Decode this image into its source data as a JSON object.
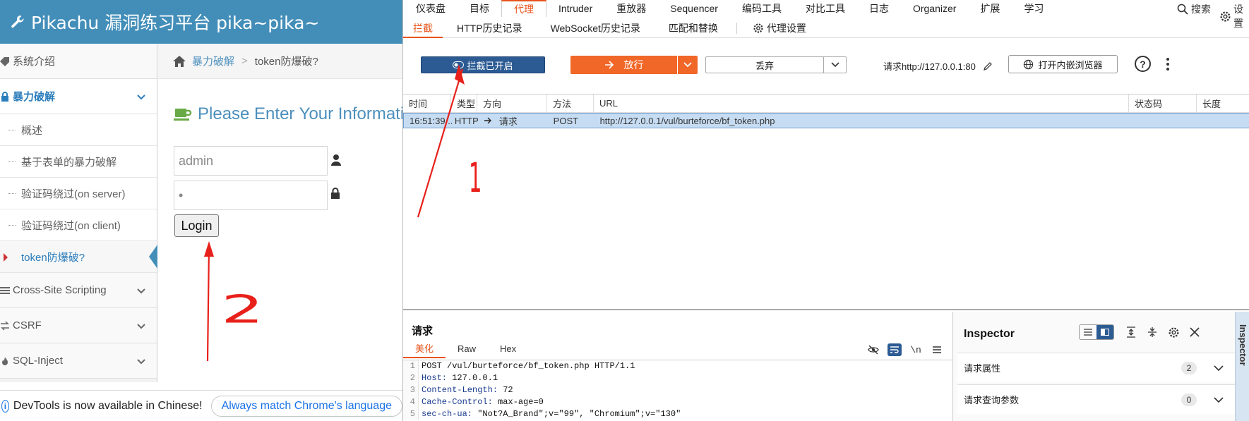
{
  "pikachu": {
    "header_title": "Pikachu 漏洞练习平台 pika~pika~",
    "sidebar": {
      "items": [
        {
          "label": "系统介绍"
        },
        {
          "label": "暴力破解"
        },
        {
          "label": "Cross-Site Scripting"
        },
        {
          "label": "CSRF"
        },
        {
          "label": "SQL-Inject"
        }
      ],
      "sub_items": [
        {
          "label": "概述"
        },
        {
          "label": "基于表单的暴力破解"
        },
        {
          "label": "验证码绕过(on server)"
        },
        {
          "label": "验证码绕过(on client)"
        },
        {
          "label": "token防爆破?"
        }
      ]
    },
    "breadcrumb": {
      "link": "暴力破解",
      "sep": ">",
      "current": "token防爆破?"
    },
    "form": {
      "title": "Please Enter Your Information",
      "username_value": "admin",
      "password_value": "•",
      "login_label": "Login"
    },
    "devtools": {
      "message": "DevTools is now available in Chinese!",
      "button": "Always match Chrome's language"
    }
  },
  "burp": {
    "tabs": [
      "仪表盘",
      "目标",
      "代理",
      "Intruder",
      "重放器",
      "Sequencer",
      "编码工具",
      "对比工具",
      "日志",
      "Organizer",
      "扩展",
      "学习"
    ],
    "active_tab": "代理",
    "search_label": "搜索",
    "settings_label": "设置",
    "sub_tabs": [
      "拦截",
      "HTTP历史记录",
      "WebSocket历史记录",
      "匹配和替换"
    ],
    "proxy_settings_label": "代理设置",
    "intercept_label": "拦截已开启",
    "forward_label": "放行",
    "drop_label": "丢弃",
    "request_target": "请求http://127.0.0.1:80",
    "open_browser_label": "打开内嵌浏览器",
    "history": {
      "columns": [
        "时间",
        "类型",
        "方向",
        "方法",
        "URL",
        "状态码",
        "长度"
      ],
      "rows": [
        {
          "time": "16:51:39 ...",
          "type": "HTTP",
          "direction": "请求",
          "method": "POST",
          "url": "http://127.0.0.1/vul/burteforce/bf_token.php",
          "status": "",
          "length": ""
        }
      ]
    },
    "request": {
      "title": "请求",
      "tabs": [
        "美化",
        "Raw",
        "Hex"
      ],
      "lines": [
        {
          "n": "1",
          "key": "",
          "text": "POST /vul/burteforce/bf_token.php HTTP/1.1"
        },
        {
          "n": "2",
          "key": "Host:",
          "text": " 127.0.0.1"
        },
        {
          "n": "3",
          "key": "Content-Length:",
          "text": " 72"
        },
        {
          "n": "4",
          "key": "Cache-Control:",
          "text": " max-age=0"
        },
        {
          "n": "5",
          "key": "sec-ch-ua:",
          "text": " \"Not?A_Brand\";v=\"99\", \"Chromium\";v=\"130\""
        }
      ]
    },
    "inspector": {
      "title": "Inspector",
      "strip_label": "Inspector",
      "rows": [
        {
          "label": "请求属性",
          "count": "2"
        },
        {
          "label": "请求查询参数",
          "count": "0"
        }
      ]
    },
    "annotations": {
      "num1": "1",
      "num2": "2"
    }
  },
  "colors": {
    "pika_header": "#438eb9",
    "burp_accent": "#e8531a",
    "forward_button": "#f06728",
    "intercept_button": "#2c5b94",
    "annotation": "#e8201a"
  }
}
